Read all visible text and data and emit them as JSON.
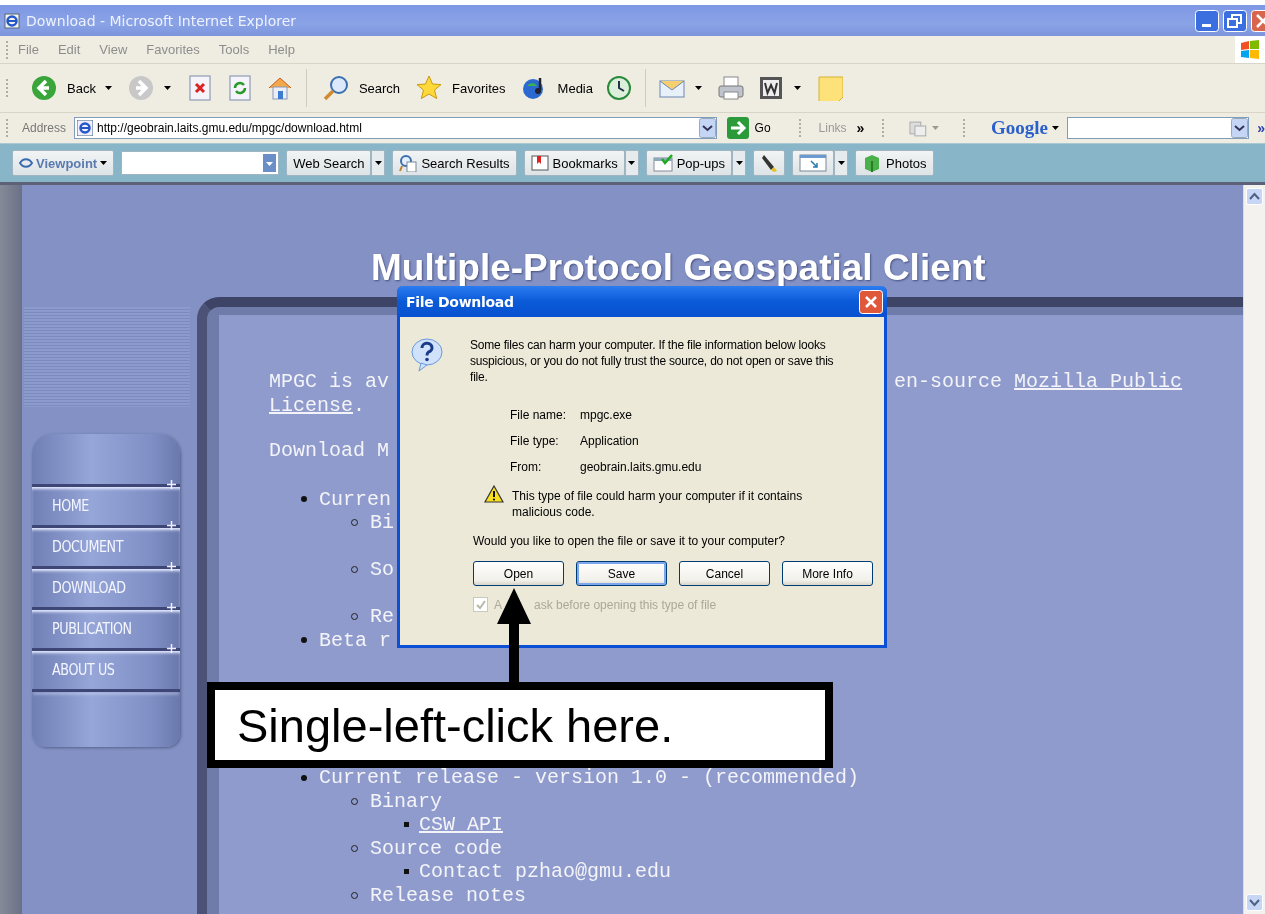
{
  "window": {
    "title": "Download - Microsoft Internet Explorer"
  },
  "menu_bar": [
    "File",
    "Edit",
    "View",
    "Favorites",
    "Tools",
    "Help"
  ],
  "toolbar": [
    {
      "kind": "back",
      "label": "Back"
    },
    {
      "kind": "forward"
    },
    {
      "kind": "stop"
    },
    {
      "kind": "refresh"
    },
    {
      "kind": "home"
    },
    {
      "kind": "separator"
    },
    {
      "kind": "search",
      "label": "Search"
    },
    {
      "kind": "favorites",
      "label": "Favorites"
    },
    {
      "kind": "media",
      "label": "Media"
    },
    {
      "kind": "history"
    },
    {
      "kind": "separator"
    },
    {
      "kind": "mail"
    },
    {
      "kind": "print"
    },
    {
      "kind": "word"
    },
    {
      "kind": "note"
    }
  ],
  "address_bar": {
    "label": "Address",
    "url": "http://geobrain.laits.gmu.edu/mpgc/download.html",
    "go": "Go",
    "links": "Links",
    "links_more": "»",
    "search_label": "Google",
    "search_more": "»"
  },
  "viewpoint_bar": [
    {
      "kind": "viewpoint",
      "label": "Viewpoint"
    },
    {
      "kind": "field"
    },
    {
      "kind": "web-search",
      "label": "Web Search"
    },
    {
      "kind": "search-results",
      "label": "Search Results"
    },
    {
      "kind": "bookmarks",
      "label": "Bookmarks"
    },
    {
      "kind": "popups",
      "label": "Pop-ups"
    },
    {
      "kind": "highlighter"
    },
    {
      "kind": "resize"
    },
    {
      "kind": "photos",
      "label": "Photos"
    }
  ],
  "page": {
    "heading": "Multiple-Protocol Geospatial Client",
    "nav": [
      "HOME",
      "DOCUMENT",
      "DOWNLOAD",
      "PUBLICATION",
      "ABOUT US"
    ],
    "intro_lines": [
      [
        [
          {
            "kind": "text",
            "text": "MPGC is av"
          }
        ],
        [
          {
            "kind": "text",
            "text": "en-source"
          },
          {
            "kind": "link",
            "text": "Mozilla Public"
          }
        ]
      ],
      [
        [
          {
            "kind": "link",
            "text": "License"
          },
          {
            "kind": "suffix",
            "text": "."
          }
        ]
      ],
      [
        [
          {
            "kind": "text",
            "text": "Download M"
          }
        ]
      ]
    ],
    "list_top": [
      {
        "text": "Curren",
        "link": false,
        "space_after": false,
        "children": [
          {
            "text": "Bi",
            "link": false,
            "space_after": true
          },
          {
            "text": "So",
            "link": false,
            "space_after": true
          },
          {
            "text": "Re",
            "link": false,
            "space_after": false
          }
        ]
      },
      {
        "text": "Beta r",
        "link": false,
        "space_after": false
      }
    ],
    "list_bottom": [
      {
        "text": "Current release - version 1.0 - (recommended)",
        "link": false,
        "children": [
          {
            "text": "Binary",
            "link": false,
            "children": [
              {
                "text": "CSW API",
                "link": true
              }
            ]
          },
          {
            "text": "Source code",
            "link": false,
            "children": [
              {
                "text": "Contact pzhao@gmu.edu",
                "link": false
              }
            ]
          },
          {
            "text": "Release notes",
            "link": false
          }
        ]
      }
    ]
  },
  "dialog": {
    "title": "File Download",
    "message": "Some files can harm your computer. If the file information below looks suspicious, or you do not fully trust the source, do not open or save this file.",
    "fields": [
      {
        "label": "File name:",
        "value": "mpgc.exe"
      },
      {
        "label": "File type:",
        "value": "Application"
      },
      {
        "label": "From:",
        "value": "geobrain.laits.gmu.edu"
      }
    ],
    "warning": "This type of file could harm your computer if it contains malicious code.",
    "question": "Would you like to open the file or save it to your computer?",
    "buttons": [
      {
        "label": "Open",
        "focused": false
      },
      {
        "label": "Save",
        "focused": true
      },
      {
        "label": "Cancel",
        "focused": false
      },
      {
        "label": "More Info",
        "focused": false
      }
    ],
    "checkbox": {
      "checked": true,
      "disabled": true,
      "label_parts": [
        "A",
        "ask before opening this type of file"
      ]
    }
  },
  "callout": {
    "text": "Single-left-click here."
  }
}
